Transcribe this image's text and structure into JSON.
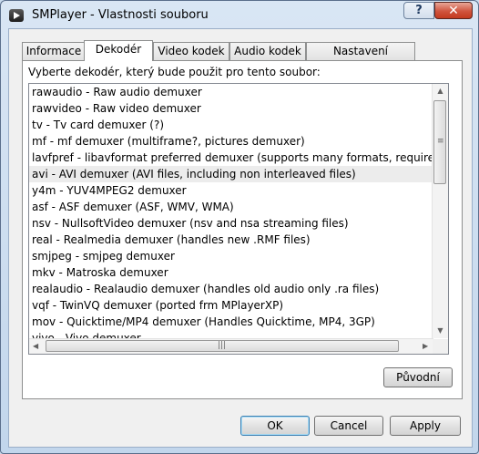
{
  "window": {
    "title": "SMPlayer - Vlastnosti souboru",
    "help_label": "?",
    "close_label": "✕"
  },
  "tabs": [
    {
      "label": "Informace",
      "active": false
    },
    {
      "label": "Dekodér",
      "active": true
    },
    {
      "label": "Video kodek",
      "active": false
    },
    {
      "label": "Audio kodek",
      "active": false
    },
    {
      "label": "Nastavení MPlayeru",
      "active": false
    }
  ],
  "panel": {
    "instruction": "Vyberte dekodér, který bude použit pro tento soubor:",
    "selected_index": 5,
    "items": [
      "rawaudio - Raw audio demuxer",
      "rawvideo - Raw video demuxer",
      "tv - Tv card demuxer (?)",
      "mf - mf demuxer (multiframe?, pictures demuxer)",
      "lavfpref - libavformat preferred demuxer (supports many formats, requires libavformat)",
      "avi - AVI demuxer (AVI files, including non interleaved files)",
      "y4m - YUV4MPEG2 demuxer",
      "asf - ASF demuxer (ASF, WMV, WMA)",
      "nsv - NullsoftVideo demuxer (nsv and nsa streaming files)",
      "real - Realmedia demuxer (handles new .RMF files)",
      "smjpeg - smjpeg demuxer",
      "mkv - Matroska demuxer",
      "realaudio - Realaudio demuxer (handles old audio only .ra files)",
      "vqf - TwinVQ demuxer (ported frm MPlayerXP)",
      "mov - Quicktime/MP4 demuxer (Handles Quicktime, MP4, 3GP)",
      "vivo - Vivo demuxer"
    ],
    "reset_label": "Původní"
  },
  "buttons": {
    "ok": "OK",
    "cancel": "Cancel",
    "apply": "Apply"
  }
}
